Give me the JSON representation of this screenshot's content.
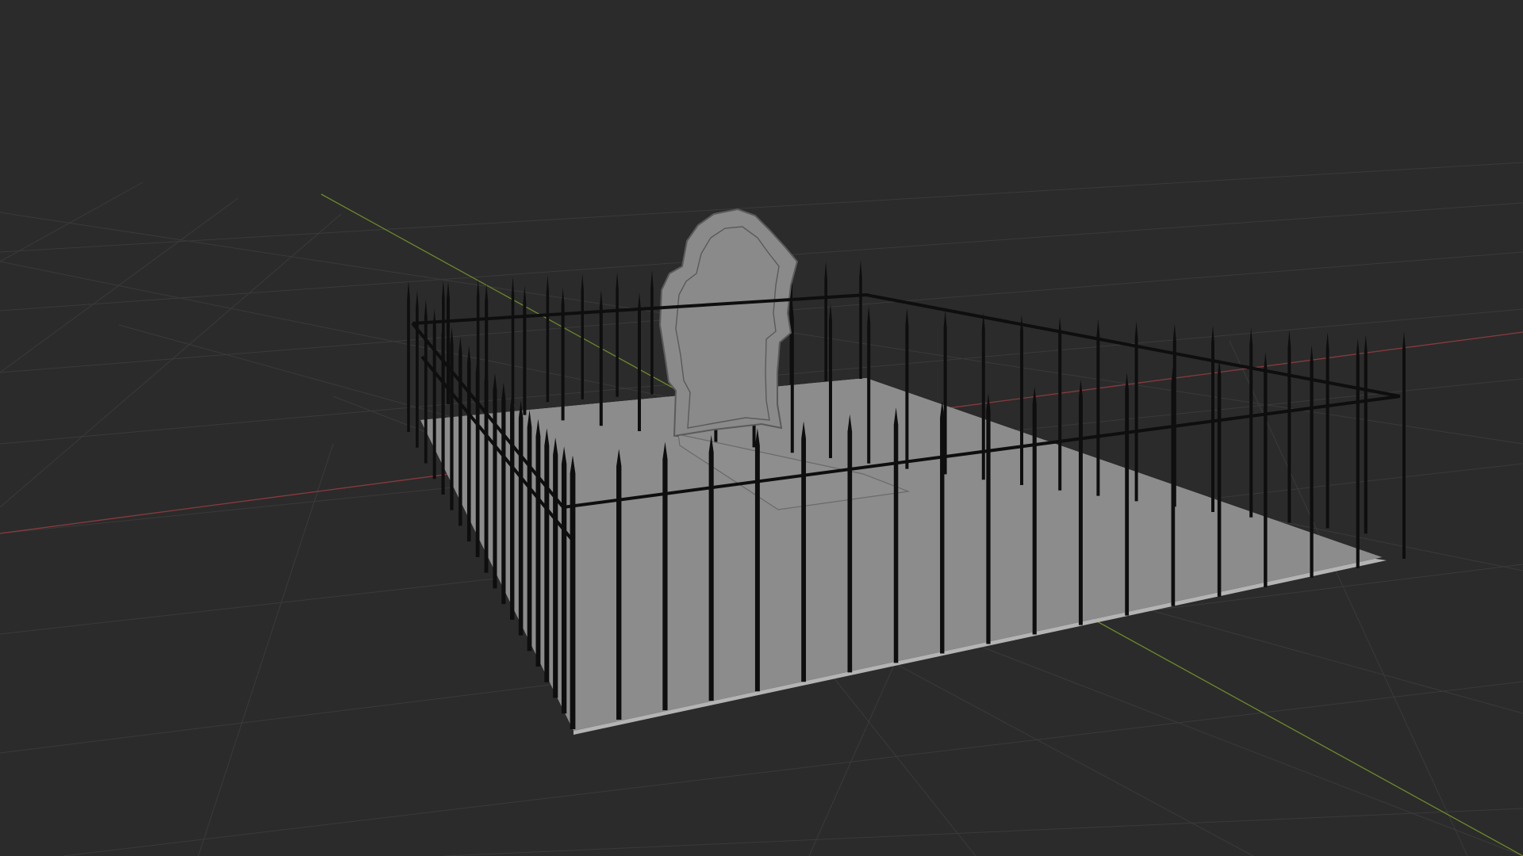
{
  "app": "3D viewport",
  "viewport": {
    "shading": "solid",
    "background_color": "#2b2b2b",
    "grid_color": "#3a3a3a",
    "x_axis_color": "#8a3a3e",
    "y_axis_color": "#6c8a2a",
    "show_floor_grid": true,
    "show_x_axis": true,
    "show_y_axis": true
  },
  "scene": {
    "objects": [
      {
        "name": "ground-plane",
        "color": "#8c8c8c"
      },
      {
        "name": "headstone",
        "color": "#8a8a8a",
        "outline_color": "#5a5a5a"
      },
      {
        "name": "grave-slab",
        "color": "#8e8e8e"
      },
      {
        "name": "iron-fence",
        "color": "#0e0e0e"
      }
    ]
  }
}
